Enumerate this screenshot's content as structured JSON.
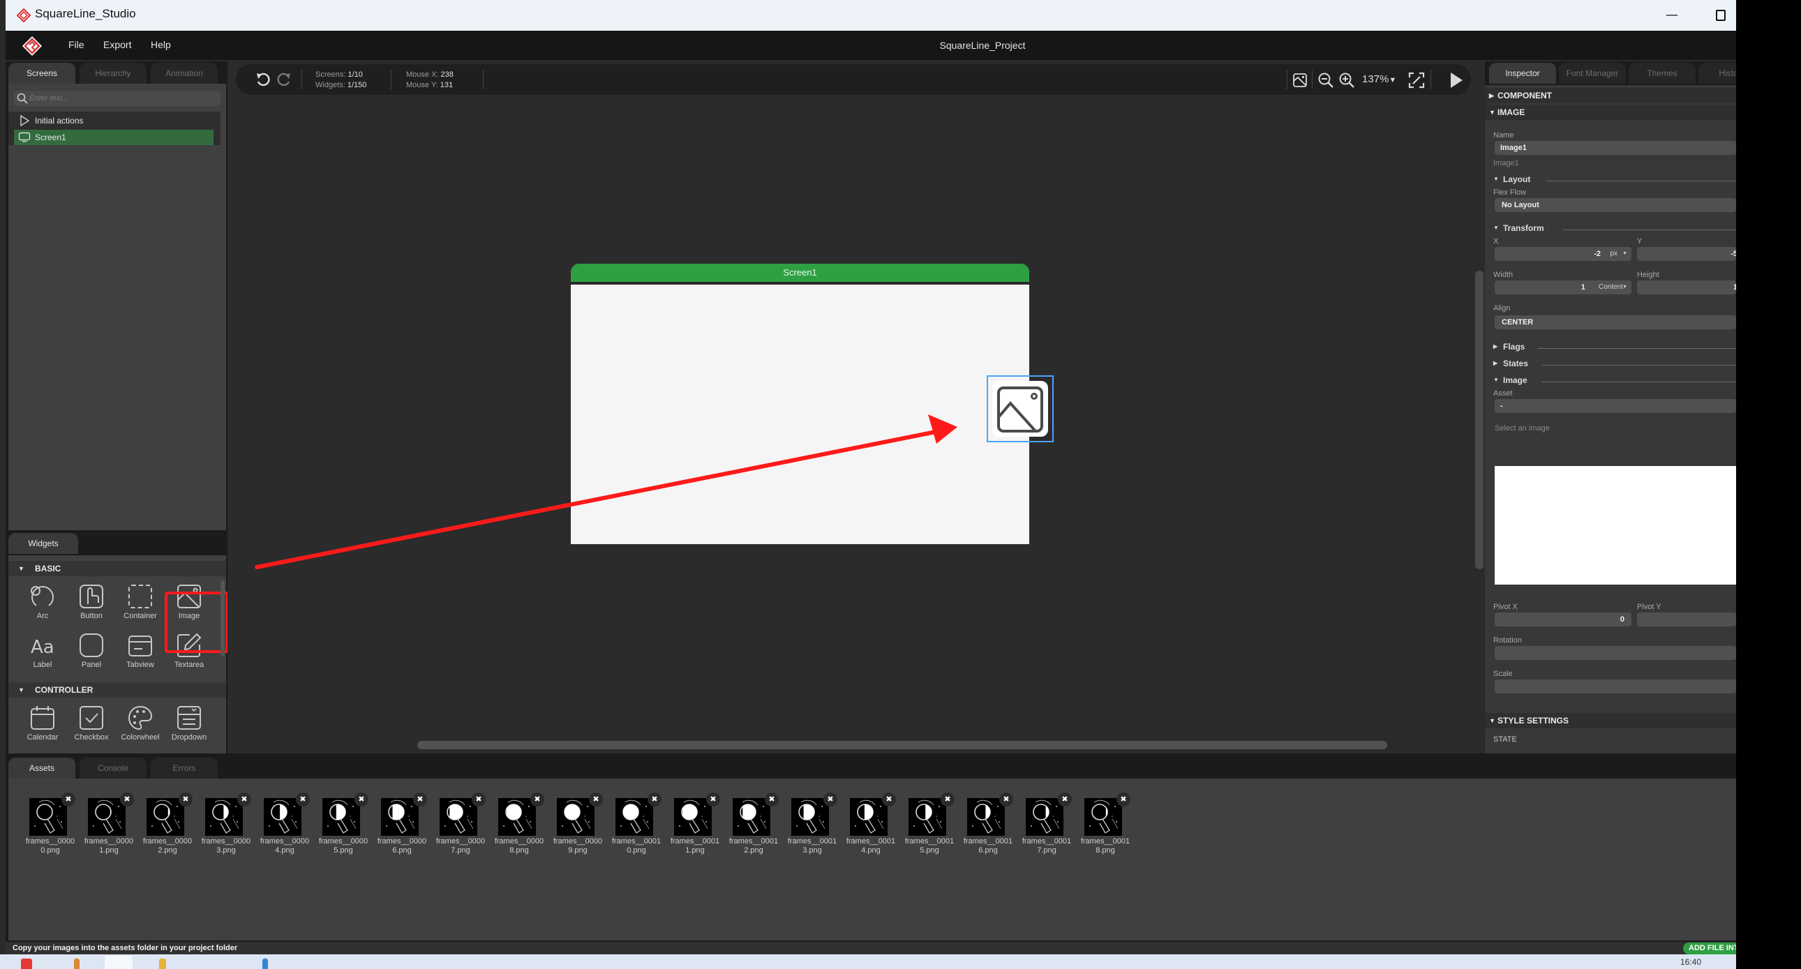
{
  "window": {
    "title": "SquareLine_Studio",
    "minimize_icon": "minimize-icon",
    "maximize_icon": "maximize-icon"
  },
  "menubar": {
    "items": [
      "File",
      "Export",
      "Help"
    ],
    "project_title": "SquareLine_Project"
  },
  "left_panel": {
    "tabs": [
      {
        "label": "Screens",
        "active": true
      },
      {
        "label": "Hierarchy",
        "active": false
      },
      {
        "label": "Animation",
        "active": false
      }
    ],
    "search": {
      "placeholder": "Enter text...",
      "value": ""
    },
    "list": [
      {
        "label": "Initial actions",
        "icon": "play-outline-icon",
        "selected": false
      },
      {
        "label": "Screen1",
        "icon": "monitor-icon",
        "selected": true
      }
    ]
  },
  "widgets": {
    "tab_label": "Widgets",
    "sections": [
      {
        "title": "BASIC",
        "items": [
          {
            "label": "Arc",
            "icon": "arc-icon"
          },
          {
            "label": "Button",
            "icon": "button-hand-icon"
          },
          {
            "label": "Container",
            "icon": "container-dashed-icon"
          },
          {
            "label": "Image",
            "icon": "image-icon",
            "highlighted": true
          },
          {
            "label": "Label",
            "icon": "label-aa-icon"
          },
          {
            "label": "Panel",
            "icon": "panel-icon"
          },
          {
            "label": "Tabview",
            "icon": "tabview-icon"
          },
          {
            "label": "Textarea",
            "icon": "textarea-pencil-icon"
          }
        ]
      },
      {
        "title": "CONTROLLER",
        "items": [
          {
            "label": "Calendar",
            "icon": "calendar-icon"
          },
          {
            "label": "Checkbox",
            "icon": "checkbox-icon"
          },
          {
            "label": "Colorwheel",
            "icon": "palette-icon"
          },
          {
            "label": "Dropdown",
            "icon": "dropdown-icon"
          }
        ]
      }
    ]
  },
  "canvas_toolbar": {
    "screens_label": "Screens:",
    "screens_value": "1/10",
    "widgets_label": "Widgets:",
    "widgets_value": "1/150",
    "mouse_x_label": "Mouse X:",
    "mouse_x_value": "238",
    "mouse_y_label": "Mouse Y:",
    "mouse_y_value": "131",
    "zoom": "137%"
  },
  "canvas": {
    "screen_name": "Screen1",
    "selected_widget": "Image1",
    "accent_color": "#2ea043",
    "selection_color": "#4aa3ff",
    "annotation_color": "#ff1a1a"
  },
  "inspector": {
    "tabs": [
      {
        "label": "Inspector",
        "active": true
      },
      {
        "label": "Font Manager",
        "active": false
      },
      {
        "label": "Themes",
        "active": false
      },
      {
        "label": "History",
        "active": false
      }
    ],
    "component_header": "COMPONENT",
    "image_header": "IMAGE",
    "name_label": "Name",
    "name_value": "Image1",
    "name_hint": "Image1",
    "layout_section": "Layout",
    "flex_flow_label": "Flex Flow",
    "flex_flow_value": "No Layout",
    "transform_section": "Transform",
    "x_label": "X",
    "x_value": "-2",
    "x_unit": "px",
    "y_label": "Y",
    "y_value": "-5",
    "width_label": "Width",
    "width_value": "1",
    "width_unit": "Content",
    "height_label": "Height",
    "height_value": "1",
    "align_label": "Align",
    "align_value": "CENTER",
    "flags_section": "Flags",
    "states_section": "States",
    "image_section": "Image",
    "asset_label": "Asset",
    "asset_value": "-",
    "asset_hint": "Select an image",
    "pivot_x_label": "Pivot X",
    "pivot_x_value": "0",
    "pivot_y_label": "Pivot Y",
    "pivot_y_value": "",
    "rotation_label": "Rotation",
    "rotation_value": "",
    "scale_label": "Scale",
    "scale_value": "",
    "style_header": "STYLE SETTINGS",
    "state_label": "STATE"
  },
  "bottom_panel": {
    "tabs": [
      {
        "label": "Assets",
        "active": true
      },
      {
        "label": "Console",
        "active": false
      },
      {
        "label": "Errors",
        "active": false
      }
    ],
    "assets": [
      {
        "line1": "frames__0000",
        "line2": "0.png",
        "fill": 0.0
      },
      {
        "line1": "frames__0000",
        "line2": "1.png",
        "fill": 0.05
      },
      {
        "line1": "frames__0000",
        "line2": "2.png",
        "fill": 0.1
      },
      {
        "line1": "frames__0000",
        "line2": "3.png",
        "fill": 0.3
      },
      {
        "line1": "frames__0000",
        "line2": "4.png",
        "fill": 0.45
      },
      {
        "line1": "frames__0000",
        "line2": "5.png",
        "fill": 0.6
      },
      {
        "line1": "frames__0000",
        "line2": "6.png",
        "fill": 0.75
      },
      {
        "line1": "frames__0000",
        "line2": "7.png",
        "fill": 0.85
      },
      {
        "line1": "frames__0000",
        "line2": "8.png",
        "fill": 0.95
      },
      {
        "line1": "frames__0000",
        "line2": "9.png",
        "fill": 1.0
      },
      {
        "line1": "frames__0001",
        "line2": "0.png",
        "fill": 1.0
      },
      {
        "line1": "frames__0001",
        "line2": "1.png",
        "fill": 0.95
      },
      {
        "line1": "frames__0001",
        "line2": "2.png",
        "fill": 0.85
      },
      {
        "line1": "frames__0001",
        "line2": "3.png",
        "fill": 0.7
      },
      {
        "line1": "frames__0001",
        "line2": "4.png",
        "fill": 0.55
      },
      {
        "line1": "frames__0001",
        "line2": "5.png",
        "fill": 0.4
      },
      {
        "line1": "frames__0001",
        "line2": "6.png",
        "fill": 0.3
      },
      {
        "line1": "frames__0001",
        "line2": "7.png",
        "fill": 0.2
      },
      {
        "line1": "frames__0001",
        "line2": "8.png",
        "fill": 0.1
      }
    ]
  },
  "statusbar": {
    "message": "Copy your images into the assets folder in your project folder",
    "add_file_label": "ADD FILE INTO ASSETS"
  },
  "taskbar": {
    "clock": "16:40"
  }
}
